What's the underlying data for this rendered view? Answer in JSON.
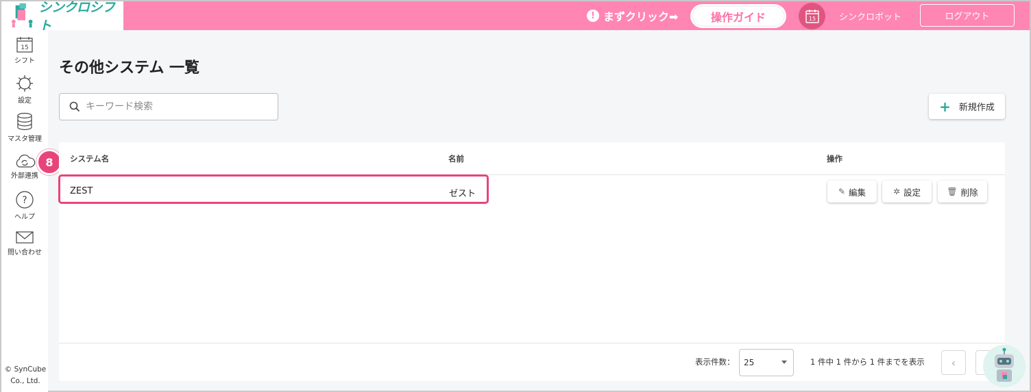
{
  "header": {
    "app_name": "シンクロシフト",
    "click_hint": "まずクリック➡",
    "hint_icon": "!",
    "guide_label": "操作ガイド",
    "robot_label": "シンクロボット",
    "robot_icon_day": "15",
    "logout_label": "ログアウト",
    "color": "#ff85b3"
  },
  "sidebar": {
    "items": [
      {
        "label": "シフト",
        "icon": "calendar-icon",
        "day": "15"
      },
      {
        "label": "設定",
        "icon": "gear-icon"
      },
      {
        "label": "マスタ管理",
        "icon": "database-icon"
      },
      {
        "label": "外部連携",
        "icon": "cloud-sync-icon"
      },
      {
        "label": "ヘルプ",
        "icon": "help-icon",
        "glyph": "?"
      },
      {
        "label": "問い合わせ",
        "icon": "mail-icon"
      }
    ],
    "copyright_line1": "© SynCube",
    "copyright_line2": "Co., Ltd.",
    "step_badge": "8"
  },
  "main": {
    "title": "その他システム 一覧",
    "search_placeholder": "キーワード検索",
    "new_button": "新規作成",
    "table": {
      "columns": [
        "システム名",
        "名前",
        "操作"
      ],
      "rows": [
        {
          "system_name": "ZEST",
          "name": "ゼスト"
        }
      ],
      "actions": {
        "edit": "編集",
        "settings": "設定",
        "delete": "削除"
      }
    },
    "pagination": {
      "per_page_label": "表示件数：",
      "per_page_value": "25",
      "range_text": "1 件中 1 件から 1 件までを表示",
      "prev": "‹",
      "next": "›"
    }
  },
  "accent_color": "#e8447a",
  "brand_teal": "#2aa9a0"
}
